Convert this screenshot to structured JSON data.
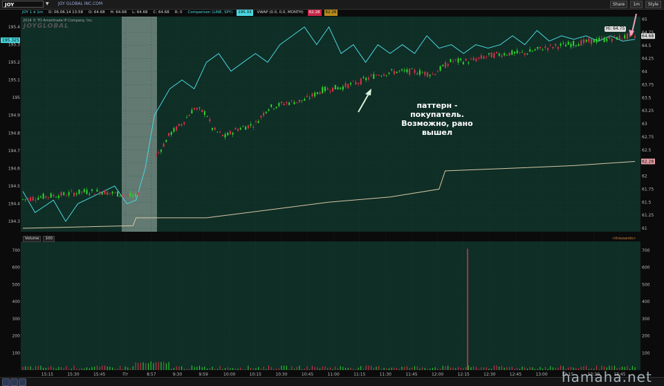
{
  "window": {
    "symbol": "JOY",
    "company": "JOY GLOBAL INC.COM",
    "buttons": [
      "Share",
      "1m",
      "Style"
    ]
  },
  "studies": {
    "header": "JOY 1 d 1m",
    "d": "D: 06.06.14 13:58",
    "o": "O: 64.68",
    "h": "H: 64.68",
    "l": "L: 64.68",
    "c": "C: 64.68",
    "r": "R: 0",
    "comparison": "Comparison (LINE, SPY)",
    "comparison_value": "195.33",
    "vwap": "VWAP (0.0, 0.0, MONTH)",
    "vwap_value": "62.28",
    "vwap_value2": "62.28"
  },
  "copyright": "2014 © TD Ameritrade IP Company, Inc.",
  "logo": "JOYGLOBAL",
  "hi_label": "Hi: 64.75",
  "annotation": "паттерн - покупатель. Возможно, рано вышел",
  "volume_panel": {
    "label": "Volume",
    "value": "100",
    "units": "<thousands>"
  },
  "watermark": "hamaha.net",
  "colors": {
    "background": "#0f2e26",
    "up": "#2fd82f",
    "down": "#e0304a",
    "comparison": "#4ad8e0",
    "vwap": "#d8c8a8",
    "highlight": "#c8d8d0"
  },
  "chart_data": {
    "type": "candlestick",
    "x_ticks": [
      "15:15",
      "15:30",
      "15:45",
      "Пт",
      "8:57",
      "9:30",
      "9:59",
      "10:00",
      "10:15",
      "10:30",
      "10:45",
      "11:00",
      "11:15",
      "11:30",
      "11:45",
      "12:00",
      "12:15",
      "12:30",
      "12:45",
      "13:00",
      "13:15",
      "13:30",
      "13:45"
    ],
    "y_left_ticks": [
      195.4,
      195.3,
      195.2,
      195.1,
      195,
      194.9,
      194.8,
      194.7,
      194.6,
      194.5,
      194.4,
      194.3
    ],
    "y_left_label_current": "195.325",
    "y_right_ticks": [
      65,
      64.75,
      64.5,
      64.25,
      64,
      63.75,
      63.5,
      63.25,
      63,
      62.75,
      62.5,
      62.25,
      62,
      61.75,
      61.5,
      61.25,
      61
    ],
    "y_right_label_last": "64.68",
    "y_right_label_vwap": "62.28",
    "y_right_range": [
      61,
      65
    ],
    "y_left_range": [
      194.3,
      195.4
    ],
    "volume_ticks": [
      700,
      600,
      500,
      400,
      300,
      200,
      100
    ],
    "volume_range": [
      0,
      700
    ],
    "volume_spike": 710,
    "price_path": [
      [
        0,
        61.55
      ],
      [
        0.03,
        61.6
      ],
      [
        0.07,
        61.65
      ],
      [
        0.1,
        61.7
      ],
      [
        0.13,
        61.7
      ],
      [
        0.16,
        61.65
      ],
      [
        0.185,
        61.6
      ],
      [
        0.21,
        62.3
      ],
      [
        0.225,
        62.5
      ],
      [
        0.24,
        62.8
      ],
      [
        0.26,
        63.0
      ],
      [
        0.28,
        63.3
      ],
      [
        0.3,
        63.2
      ],
      [
        0.31,
        62.9
      ],
      [
        0.33,
        62.75
      ],
      [
        0.35,
        62.9
      ],
      [
        0.38,
        63.0
      ],
      [
        0.4,
        63.3
      ],
      [
        0.43,
        63.4
      ],
      [
        0.46,
        63.45
      ],
      [
        0.49,
        63.65
      ],
      [
        0.52,
        63.7
      ],
      [
        0.55,
        63.8
      ],
      [
        0.58,
        63.95
      ],
      [
        0.61,
        64.0
      ],
      [
        0.64,
        64.0
      ],
      [
        0.67,
        63.95
      ],
      [
        0.7,
        64.2
      ],
      [
        0.73,
        64.2
      ],
      [
        0.76,
        64.3
      ],
      [
        0.79,
        64.35
      ],
      [
        0.82,
        64.35
      ],
      [
        0.85,
        64.45
      ],
      [
        0.88,
        64.5
      ],
      [
        0.91,
        64.55
      ],
      [
        0.94,
        64.6
      ],
      [
        0.97,
        64.65
      ],
      [
        1.0,
        64.68
      ]
    ],
    "comparison_path": [
      [
        0,
        194.47
      ],
      [
        0.02,
        194.35
      ],
      [
        0.05,
        194.42
      ],
      [
        0.07,
        194.3
      ],
      [
        0.09,
        194.4
      ],
      [
        0.12,
        194.45
      ],
      [
        0.15,
        194.5
      ],
      [
        0.17,
        194.4
      ],
      [
        0.185,
        194.42
      ],
      [
        0.2,
        194.6
      ],
      [
        0.215,
        194.9
      ],
      [
        0.24,
        195.05
      ],
      [
        0.26,
        195.1
      ],
      [
        0.28,
        195.05
      ],
      [
        0.3,
        195.2
      ],
      [
        0.32,
        195.25
      ],
      [
        0.34,
        195.15
      ],
      [
        0.36,
        195.2
      ],
      [
        0.38,
        195.25
      ],
      [
        0.4,
        195.2
      ],
      [
        0.42,
        195.3
      ],
      [
        0.44,
        195.35
      ],
      [
        0.46,
        195.4
      ],
      [
        0.48,
        195.3
      ],
      [
        0.5,
        195.4
      ],
      [
        0.52,
        195.25
      ],
      [
        0.54,
        195.3
      ],
      [
        0.56,
        195.2
      ],
      [
        0.58,
        195.3
      ],
      [
        0.6,
        195.25
      ],
      [
        0.62,
        195.3
      ],
      [
        0.64,
        195.25
      ],
      [
        0.66,
        195.35
      ],
      [
        0.68,
        195.28
      ],
      [
        0.7,
        195.3
      ],
      [
        0.72,
        195.25
      ],
      [
        0.74,
        195.3
      ],
      [
        0.76,
        195.28
      ],
      [
        0.78,
        195.3
      ],
      [
        0.8,
        195.35
      ],
      [
        0.82,
        195.3
      ],
      [
        0.84,
        195.38
      ],
      [
        0.86,
        195.32
      ],
      [
        0.88,
        195.35
      ],
      [
        0.9,
        195.33
      ],
      [
        0.92,
        195.35
      ],
      [
        0.94,
        195.32
      ],
      [
        0.96,
        195.35
      ],
      [
        0.98,
        195.32
      ],
      [
        1.0,
        195.33
      ]
    ],
    "vwap_path": [
      [
        0,
        61.0
      ],
      [
        0.18,
        61.05
      ],
      [
        0.185,
        61.2
      ],
      [
        0.3,
        61.2
      ],
      [
        0.4,
        61.35
      ],
      [
        0.5,
        61.5
      ],
      [
        0.6,
        61.6
      ],
      [
        0.68,
        61.75
      ],
      [
        0.69,
        62.1
      ],
      [
        0.8,
        62.15
      ],
      [
        0.9,
        62.2
      ],
      [
        1.0,
        62.28
      ]
    ]
  }
}
